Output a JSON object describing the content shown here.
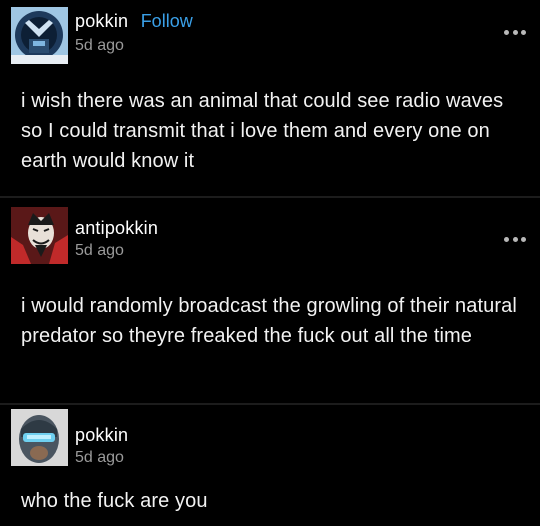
{
  "posts": [
    {
      "username": "pokkin",
      "follow_label": "Follow",
      "timestamp": "5d ago",
      "text": "i wish there was an animal that could see radio waves so I could transmit that i love them and every one on earth would know it",
      "has_more_menu": true
    },
    {
      "username": "antipokkin",
      "timestamp": "5d ago",
      "text": "i would randomly broadcast the growling of their natural predator so theyre freaked the fuck out all the time",
      "has_more_menu": true
    },
    {
      "username": "pokkin",
      "timestamp": "5d ago",
      "text": "who the fuck are you",
      "has_more_menu": false
    }
  ],
  "colors": {
    "background": "#000000",
    "text": "#f2f2f2",
    "muted": "#9a9a9a",
    "follow": "#3aa0e8"
  },
  "icons": {
    "more": "more-horizontal-icon"
  }
}
